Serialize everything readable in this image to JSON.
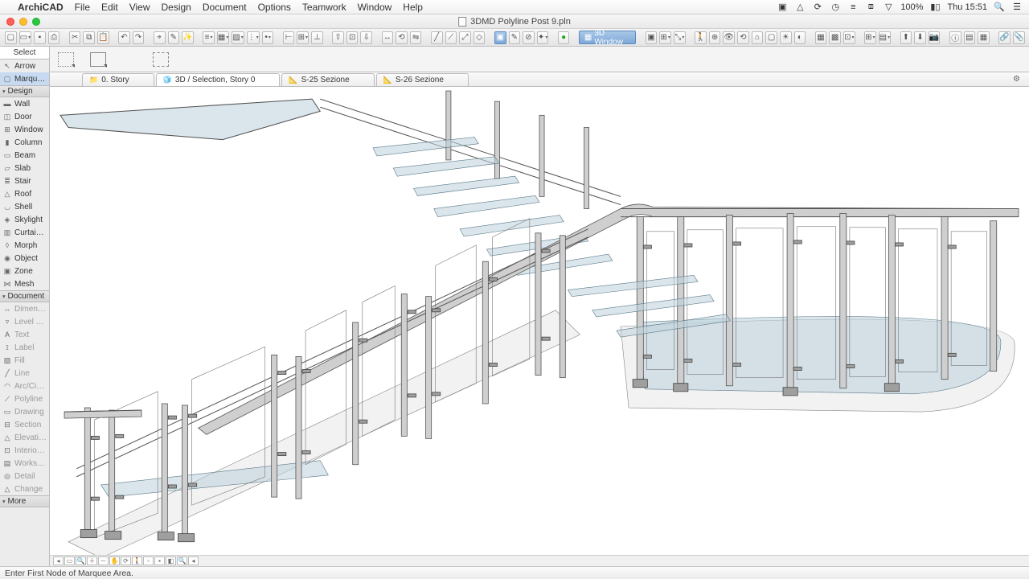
{
  "menubar": {
    "app": "ArchiCAD",
    "items": [
      "File",
      "Edit",
      "View",
      "Design",
      "Document",
      "Options",
      "Teamwork",
      "Window",
      "Help"
    ],
    "battery": "100%",
    "clock": "Thu 15:51"
  },
  "window": {
    "title": "3DMD Polyline Post 9.pln"
  },
  "toolbar": {
    "window3d_label": "3D Window"
  },
  "tabs": [
    {
      "icon": "📁",
      "label": "0. Story"
    },
    {
      "icon": "🧊",
      "label": "3D / Selection, Story 0",
      "active": true
    },
    {
      "icon": "📐",
      "label": "S-25 Sezione"
    },
    {
      "icon": "📐",
      "label": "S-26 Sezione"
    }
  ],
  "toolbox": {
    "select_header": "Select",
    "arrow": "Arrow",
    "marquee": "Marqu…",
    "design_header": "Design",
    "design_tools": [
      "Wall",
      "Door",
      "Window",
      "Column",
      "Beam",
      "Slab",
      "Stair",
      "Roof",
      "Shell",
      "Skylight",
      "Curtai…",
      "Morph",
      "Object",
      "Zone",
      "Mesh"
    ],
    "document_header": "Document",
    "document_tools": [
      "Dimen…",
      "Level …",
      "Text",
      "Label",
      "Fill",
      "Line",
      "Arc/Ci…",
      "Polyline",
      "Drawing",
      "Section",
      "Elevati…",
      "Interio…",
      "Works…",
      "Detail",
      "Change"
    ],
    "more": "More"
  },
  "status": "Enter First Node of Marquee Area."
}
